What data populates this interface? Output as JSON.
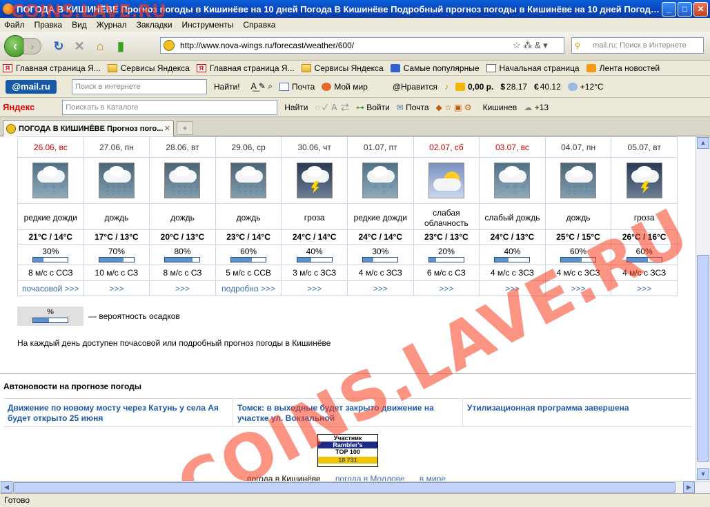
{
  "window": {
    "title": "ПОГОДА В КИШИНЁВЕ Прогноз погоды в Кишинёве  на 10 дней Погода В Кишинёве Подробный прогноз погоды в Кишинёве на 10 дней Погода ..."
  },
  "menu": [
    "Файл",
    "Правка",
    "Вид",
    "Журнал",
    "Закладки",
    "Инструменты",
    "Справка"
  ],
  "nav": {
    "url": "http://www.nova-wings.ru/forecast/weather/600/",
    "search_placeholder": "mail.ru: Поиск в Интернете"
  },
  "bookmarks": [
    {
      "label": "Главная страница Я...",
      "icon": "yandex-icon"
    },
    {
      "label": "Сервисы Яндекса",
      "icon": "folder-icon"
    },
    {
      "label": "Главная страница Я...",
      "icon": "yandex-icon"
    },
    {
      "label": "Сервисы Яндекса",
      "icon": "folder-icon"
    },
    {
      "label": "Самые популярные",
      "icon": "star-icon"
    },
    {
      "label": "Начальная страница",
      "icon": "page-icon"
    },
    {
      "label": "Лента новостей",
      "icon": "rss-icon"
    }
  ],
  "mailbar": {
    "logo": "@mail.ru",
    "search_placeholder": "Поиск в интернете",
    "find": "Найти!",
    "mail": "Почта",
    "myworld": "Мой мир",
    "like": "@Нравится",
    "money": "0,00 р.",
    "usd": "28.17",
    "eur": "40.12",
    "temp": "+12°C"
  },
  "yabar": {
    "logo": "Яндекс",
    "search_placeholder": "Поискать в Каталоге",
    "find": "Найти",
    "login": "Войти",
    "mail": "Почта",
    "city": "Кишинев",
    "temp": "+13"
  },
  "tab": {
    "title": "ПОГОДА В КИШИНЁВЕ Прогноз пого..."
  },
  "forecast": [
    {
      "date": "26.06, вс",
      "weekend": true,
      "icon": "light-rain-icon",
      "desc": "редкие дожди",
      "temp": "21°C / 14°C",
      "prob": "30%",
      "prob_value": 0.3,
      "wind": "8 м/с с ССЗ",
      "link": "почасовой >>>"
    },
    {
      "date": "27.06, пн",
      "weekend": false,
      "icon": "rain-icon",
      "desc": "дождь",
      "temp": "17°C / 13°C",
      "prob": "70%",
      "prob_value": 0.7,
      "wind": "10 м/с с СЗ",
      "link": ">>>"
    },
    {
      "date": "28.06, вт",
      "weekend": false,
      "icon": "rain-icon",
      "desc": "дождь",
      "temp": "20°C / 13°C",
      "prob": "80%",
      "prob_value": 0.8,
      "wind": "8 м/с с СЗ",
      "link": ">>>"
    },
    {
      "date": "29.06, ср",
      "weekend": false,
      "icon": "rain-icon",
      "desc": "дождь",
      "temp": "23°C / 14°C",
      "prob": "60%",
      "prob_value": 0.6,
      "wind": "5 м/с с ССВ",
      "link": "подробно >>>"
    },
    {
      "date": "30.06, чт",
      "weekend": false,
      "icon": "thunderstorm-icon",
      "desc": "гроза",
      "temp": "24°C / 14°C",
      "prob": "40%",
      "prob_value": 0.4,
      "wind": "3 м/с с ЗСЗ",
      "link": ">>>"
    },
    {
      "date": "01.07, пт",
      "weekend": false,
      "icon": "light-rain-icon",
      "desc": "редкие дожди",
      "temp": "24°C / 14°C",
      "prob": "30%",
      "prob_value": 0.3,
      "wind": "4 м/с с ЗСЗ",
      "link": ">>>"
    },
    {
      "date": "02.07, сб",
      "weekend": true,
      "icon": "partly-cloudy-icon",
      "desc": "слабая облачность",
      "temp": "23°C / 13°C",
      "prob": "20%",
      "prob_value": 0.2,
      "wind": "6 м/с с СЗ",
      "link": ">>>"
    },
    {
      "date": "03.07, вс",
      "weekend": true,
      "icon": "light-rain-icon",
      "desc": "слабый дождь",
      "temp": "24°C / 13°C",
      "prob": "40%",
      "prob_value": 0.4,
      "wind": "4 м/с с ЗСЗ",
      "link": ">>>"
    },
    {
      "date": "04.07, пн",
      "weekend": false,
      "icon": "rain-icon",
      "desc": "дождь",
      "temp": "25°C / 15°C",
      "prob": "60%",
      "prob_value": 0.6,
      "wind": "4 м/с с ЗСЗ",
      "link": ">>>"
    },
    {
      "date": "05.07, вт",
      "weekend": false,
      "icon": "thunderstorm-icon",
      "desc": "гроза",
      "temp": "26°C / 16°C",
      "prob": "60%",
      "prob_value": 0.6,
      "wind": "4 м/с с ЗСЗ",
      "link": ">>>"
    }
  ],
  "legend": {
    "label": "%",
    "text": "— вероятность осадков"
  },
  "note": "На каждый день доступен почасовой или подробный прогноз погоды в Кишинёве",
  "news": {
    "heading": "Автоновости на прогнозе погоды",
    "items": [
      "Движение по новому мосту через Катунь у села Ая будет открыто 25 июня",
      "Томск: в выходные будет закрыто движение на участке ул. Вокзальной",
      "Утилизационная программа завершена"
    ]
  },
  "badge": {
    "line1": "Участник",
    "line2": "Rambler's",
    "line3": "TOP 100",
    "line4": "18 731"
  },
  "footer": [
    "погода в Кишинёве",
    "погода в Молдове",
    "в мире"
  ],
  "status": "Готово",
  "watermark": "COINS.LAVE.RU",
  "watermark_top": "COINS.LAVE.RU"
}
